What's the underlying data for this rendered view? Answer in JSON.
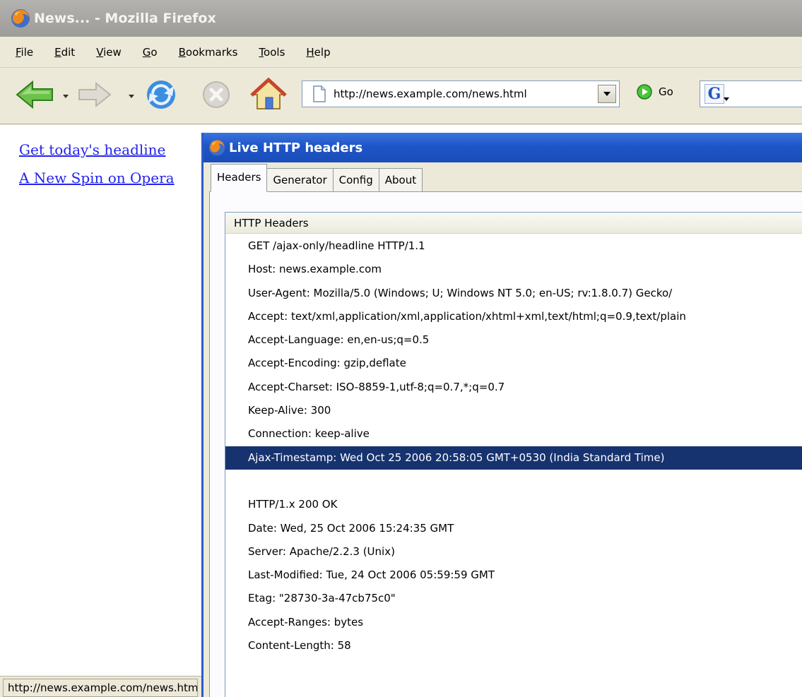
{
  "browser": {
    "window_title": "News... - Mozilla Firefox",
    "menu": [
      "File",
      "Edit",
      "View",
      "Go",
      "Bookmarks",
      "Tools",
      "Help"
    ],
    "url": "http://news.example.com/news.html",
    "go_label": "Go",
    "search_engine_letter": "G",
    "status_text": "http://news.example.com/news.html"
  },
  "page": {
    "links": [
      "Get today's headline",
      "A New Spin on Opera"
    ]
  },
  "dialog": {
    "title": "Live HTTP headers",
    "tabs": [
      "Headers",
      "Generator",
      "Config",
      "About"
    ],
    "active_tab": "Headers",
    "list_header": "HTTP Headers",
    "rows": [
      "GET /ajax-only/headline HTTP/1.1",
      "Host: news.example.com",
      "User-Agent: Mozilla/5.0 (Windows; U; Windows NT 5.0; en-US; rv:1.8.0.7) Gecko/",
      "Accept: text/xml,application/xml,application/xhtml+xml,text/html;q=0.9,text/plain",
      "Accept-Language: en,en-us;q=0.5",
      "Accept-Encoding: gzip,deflate",
      "Accept-Charset: ISO-8859-1,utf-8;q=0.7,*;q=0.7",
      "Keep-Alive: 300",
      "Connection: keep-alive",
      "Ajax-Timestamp: Wed Oct 25 2006 20:58:05 GMT+0530 (India Standard Time)",
      "",
      "HTTP/1.x 200 OK",
      "Date: Wed, 25 Oct 2006 15:24:35 GMT",
      "Server: Apache/2.2.3 (Unix)",
      "Last-Modified: Tue, 24 Oct 2006 05:59:59 GMT",
      "Etag: \"28730-3a-47cb75c0\"",
      "Accept-Ranges: bytes",
      "Content-Length: 58"
    ],
    "selected_row": 9
  },
  "colors": {
    "selection_bg": "#16336f",
    "dialog_title_bg": "#1e55c8",
    "link": "#2323ee"
  }
}
